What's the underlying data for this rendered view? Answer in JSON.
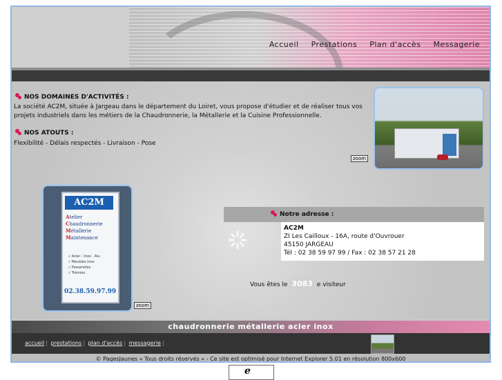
{
  "nav": [
    "Accueil",
    "Prestations",
    "Plan d'accès",
    "Messagerie"
  ],
  "domaines": {
    "title": "NOS DOMAINES D'ACTIVITÉS :",
    "line1": "La société AC2M, située à Jargeau dans le département du Loiret, vous propose d'étudier et de réaliser tous vos",
    "line2": "projets industriels dans les métiers de la Chaudronnerie, la Métallerie et la Cuisine Professionnelle."
  },
  "atouts": {
    "title": "NOS ATOUTS :",
    "text": "Flexibilité - Délais respectés - Livraison - Pose"
  },
  "zoom_label": "zoom",
  "sign": {
    "logo": "AC2M",
    "l1_letter": "A",
    "l1": "telier",
    "l2_letter": "C",
    "l2": "haudronnerie",
    "l3_letter": "M",
    "l3": "étallerie",
    "l4_letter": "M",
    "l4": "aintenance",
    "b1": "√ Acier - Inox - Alu",
    "b2": "√ Meubles Inox",
    "b3": "√ Passerelles",
    "b4": "√ Trémies",
    "tel": "02.38.59.97.99"
  },
  "address": {
    "title": "Notre adresse :",
    "name": "AC2M",
    "street": "ZI Les Cailloux - 16A, route d'Ouvrouer",
    "city": "45150 JARGEAU",
    "phone": "Tél : 02 38 59 97 99 / Fax : 02 38 57 21 28"
  },
  "visitor": {
    "before": "Vous êtes le",
    "count": "3083",
    "after": "e visiteur"
  },
  "tagline": "chaudronnerie métallerie acier inox",
  "footer_links": [
    "accueil",
    "prestations",
    "plan d'accès",
    "messagerie"
  ],
  "copyright": "© PagesJaunes « Tous droits réservés » - Ce site est optimisé pour Internet Explorer 5.01 en résolution 800x600",
  "badge": "e",
  "colors": {
    "frame_border": "#8fb6e3",
    "bullet": "#d9185b",
    "header_pink": "#e084ac"
  }
}
